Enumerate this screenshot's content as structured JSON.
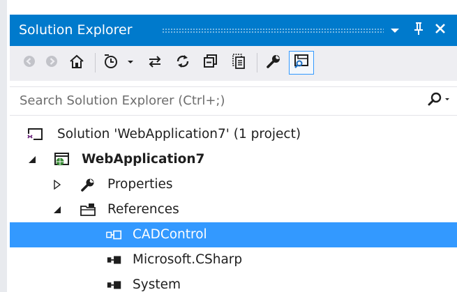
{
  "panel": {
    "title": "Solution Explorer",
    "controls": {
      "dropdown_icon": "chevron-down-icon",
      "pin_icon": "pin-icon",
      "close_icon": "close-icon"
    }
  },
  "toolbar": {
    "buttons": [
      {
        "name": "back-icon"
      },
      {
        "name": "forward-icon"
      },
      {
        "name": "home-icon"
      },
      {
        "name": "pending-changes-filter-icon"
      },
      {
        "name": "sync-with-active-document-icon"
      },
      {
        "name": "refresh-icon"
      },
      {
        "name": "collapse-all-icon"
      },
      {
        "name": "show-all-files-icon"
      },
      {
        "name": "properties-wrench-icon"
      },
      {
        "name": "preview-selected-items-icon",
        "active": true
      }
    ]
  },
  "search": {
    "placeholder": "Search Solution Explorer (Ctrl+;)",
    "icon": "search-icon"
  },
  "tree": {
    "items": [
      {
        "label": "Solution 'WebApplication7' (1 project)",
        "icon": "solution-icon",
        "expander": "none",
        "bold": false,
        "selected": false
      },
      {
        "label": "WebApplication7",
        "icon": "web-project-icon",
        "expander": "expanded",
        "bold": true,
        "selected": false
      },
      {
        "label": "Properties",
        "icon": "wrench-icon",
        "expander": "collapsed",
        "bold": false,
        "selected": false
      },
      {
        "label": "References",
        "icon": "references-folder-icon",
        "expander": "expanded",
        "bold": false,
        "selected": false
      },
      {
        "label": "CADControl",
        "icon": "reference-icon",
        "expander": "none",
        "bold": false,
        "selected": true
      },
      {
        "label": "Microsoft.CSharp",
        "icon": "reference-icon",
        "expander": "none",
        "bold": false,
        "selected": false
      },
      {
        "label": "System",
        "icon": "reference-icon",
        "expander": "none",
        "bold": false,
        "selected": false
      }
    ]
  },
  "colors": {
    "titlebar": "#007acc",
    "selection": "#3399ff",
    "toolbar_bg": "#eeeef2",
    "text": "#1e1e1e"
  }
}
